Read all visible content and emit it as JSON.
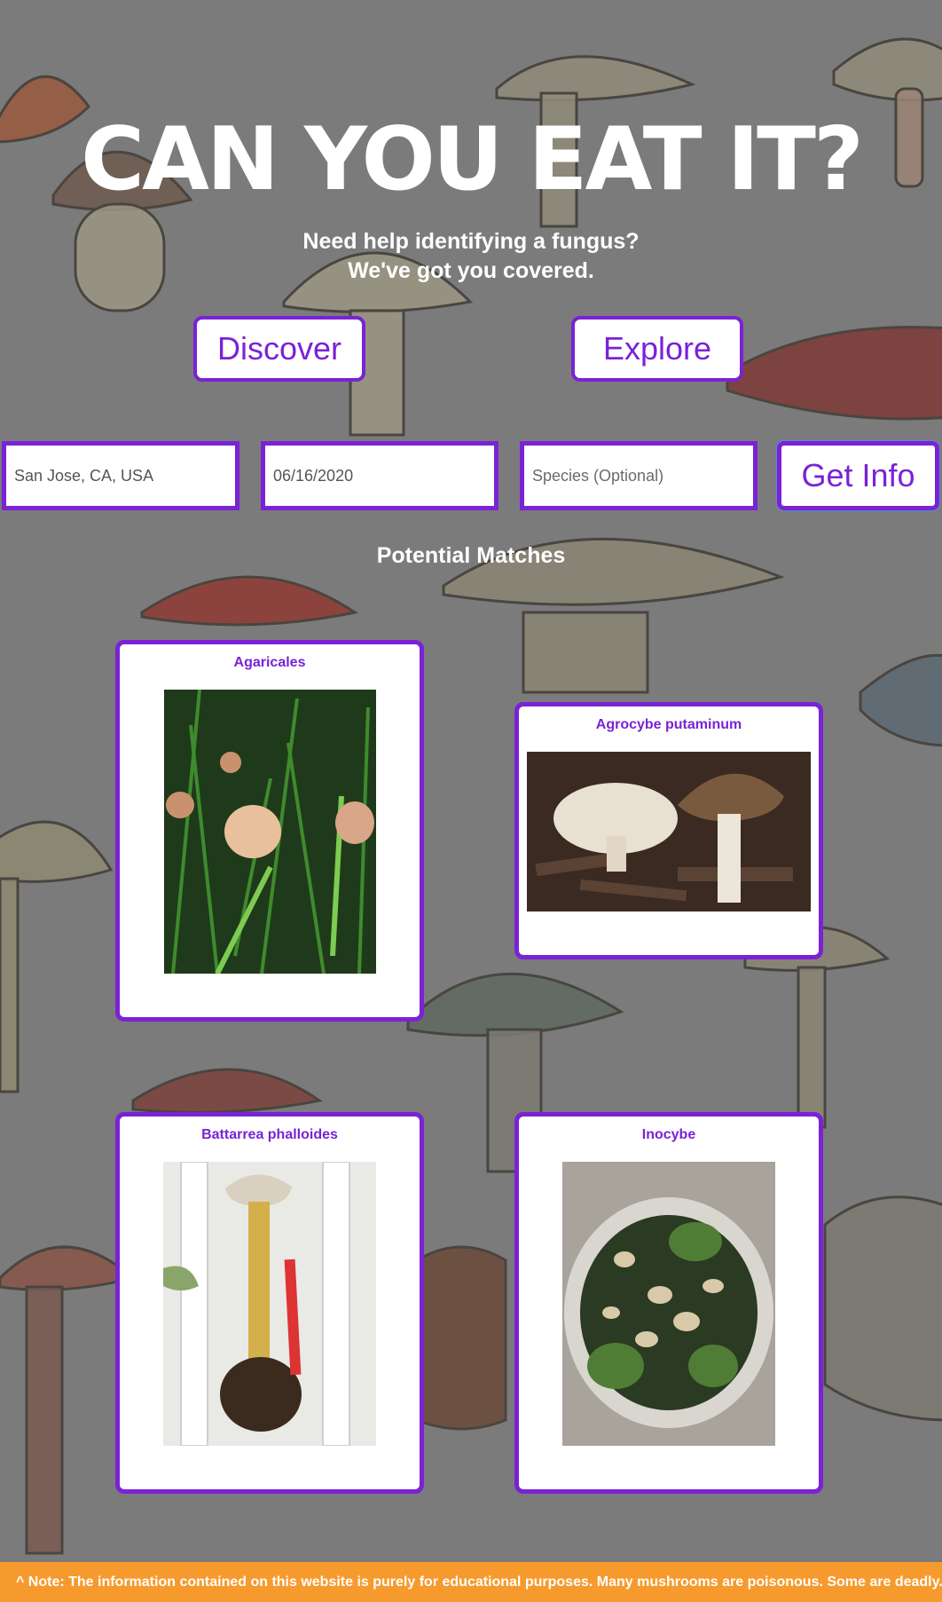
{
  "hero": {
    "title": "CAN YOU EAT IT?",
    "subtitle_line1": "Need help identifying a fungus?",
    "subtitle_line2": "We've got you covered."
  },
  "nav": {
    "discover_label": "Discover",
    "explore_label": "Explore"
  },
  "search": {
    "location_value": "San Jose, CA, USA",
    "date_value": "06/16/2020",
    "species_placeholder": "Species (Optional)",
    "submit_label": "Get Info"
  },
  "results": {
    "heading": "Potential Matches",
    "cards": [
      {
        "name": "Agaricales",
        "photo": "small tan mushrooms in green grass"
      },
      {
        "name": "Agrocybe putaminum",
        "photo": "pale and brown capped mushrooms on wood chips"
      },
      {
        "name": "Battarrea phalloides",
        "photo": "tall stalked mushroom beside a red pen"
      },
      {
        "name": "Inocybe",
        "photo": "bowl of small mushrooms with moss"
      }
    ]
  },
  "footer": {
    "note": "^ Note: The information contained on this website is purely for educational purposes. Many mushrooms are poisonous. Some are deadly. The"
  },
  "colors": {
    "accent": "#7a22d6",
    "background": "#7b7b7b",
    "footer": "#f79a2d"
  }
}
